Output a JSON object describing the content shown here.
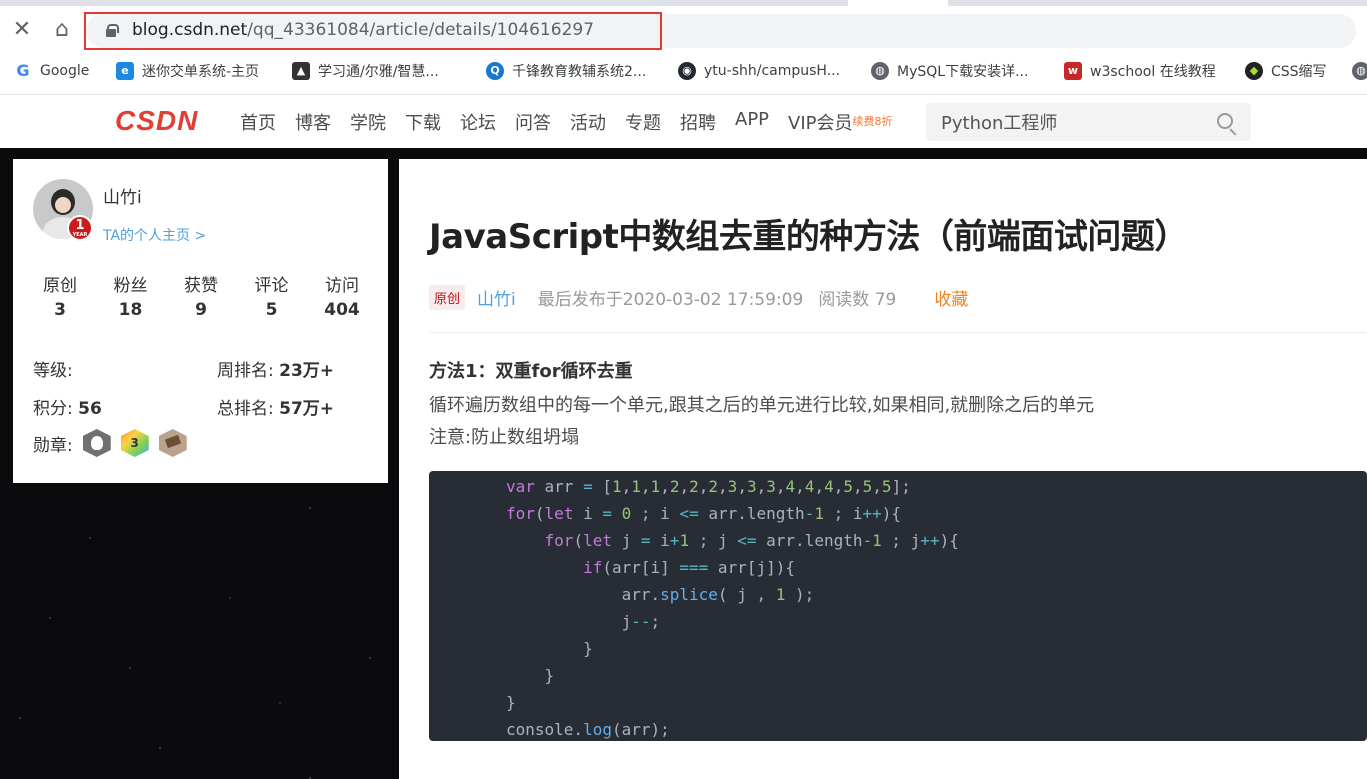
{
  "browser": {
    "url_host": "blog.csdn.net",
    "url_path": "/qq_43361084/article/details/104616297",
    "bookmarks": [
      {
        "label": "Google",
        "icon": "google-icon",
        "color": "#4285f4"
      },
      {
        "label": "迷你交单系统-主页",
        "icon": "ie-icon",
        "color": "#1e88e5"
      },
      {
        "label": "学习通/尔雅/智慧...",
        "icon": "graduation-cap-icon",
        "color": "#333333"
      },
      {
        "label": "千锋教育教辅系统2...",
        "icon": "qf-icon",
        "color": "#1976d2"
      },
      {
        "label": "ytu-shh/campusH...",
        "icon": "github-icon",
        "color": "#24292e"
      },
      {
        "label": "MySQL下载安装详...",
        "icon": "globe-icon",
        "color": "#5f6368"
      },
      {
        "label": "w3school 在线教程",
        "icon": "w3school-icon",
        "color": "#c62828"
      },
      {
        "label": "CSS缩写",
        "icon": "css-icon",
        "color": "#222222"
      }
    ]
  },
  "header": {
    "logo": "CSDN",
    "menu": [
      "首页",
      "博客",
      "学院",
      "下载",
      "论坛",
      "问答",
      "活动",
      "专题",
      "招聘",
      "APP",
      "VIP会员"
    ],
    "vip_tag": "续费8折",
    "search_value": "Python工程师"
  },
  "profile": {
    "username": "山竹i",
    "homepage_link": "TA的个人主页 >",
    "year_badge": "1",
    "year_badge_sub": "YEAR",
    "stats": [
      {
        "label": "原创",
        "value": "3"
      },
      {
        "label": "粉丝",
        "value": "18"
      },
      {
        "label": "获赞",
        "value": "9"
      },
      {
        "label": "评论",
        "value": "5"
      },
      {
        "label": "访问",
        "value": "404"
      }
    ],
    "level_label": "等级:",
    "points_label": "积分:",
    "points_value": "56",
    "week_rank_label": "周排名:",
    "week_rank_value": "23万+",
    "total_rank_label": "总排名:",
    "total_rank_value": "57万+",
    "medals_label": "勋章:",
    "medal_2_text": "3"
  },
  "article": {
    "title": "JavaScript中数组去重的种方法（前端面试问题）",
    "original_tag": "原创",
    "author": "山竹i",
    "date": "最后发布于2020-03-02 17:59:09",
    "reads": "阅读数 79",
    "favorite": "收藏",
    "method1_title": "方法1：双重for循环去重",
    "method1_desc": "循环遍历数组中的每一个单元,跟其之后的单元进行比较,如果相同,就删除之后的单元",
    "method1_note": "注意:防止数组坍塌"
  }
}
